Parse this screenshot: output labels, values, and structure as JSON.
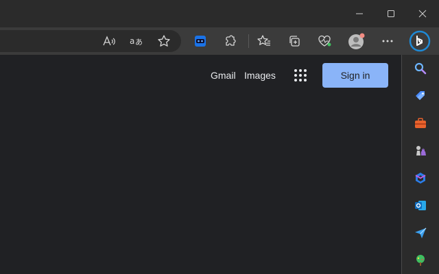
{
  "window": {
    "controls": [
      {
        "name": "minimize-icon"
      },
      {
        "name": "maximize-icon"
      },
      {
        "name": "close-icon"
      }
    ]
  },
  "toolbar": {
    "icons": [
      "read-aloud-icon",
      "translate-icon",
      "favorite-star-icon",
      "extension-badge-icon",
      "extensions-puzzle-icon",
      "favorites-icon",
      "collections-icon",
      "browser-essentials-icon",
      "profile-avatar-icon",
      "more-options-icon",
      "bing-copilot-icon"
    ]
  },
  "page": {
    "gmail_label": "Gmail",
    "images_label": "Images",
    "signin_label": "Sign in"
  },
  "sidebar": {
    "icons": [
      "search-icon",
      "shopping-tag-icon",
      "tools-briefcase-icon",
      "games-chess-icon",
      "microsoft-365-icon",
      "outlook-icon",
      "drop-send-icon",
      "tree-icon"
    ]
  },
  "colors": {
    "accent": "#8ab4f8",
    "page_bg": "#202124",
    "toolbar_bg": "#3b3b3b"
  }
}
